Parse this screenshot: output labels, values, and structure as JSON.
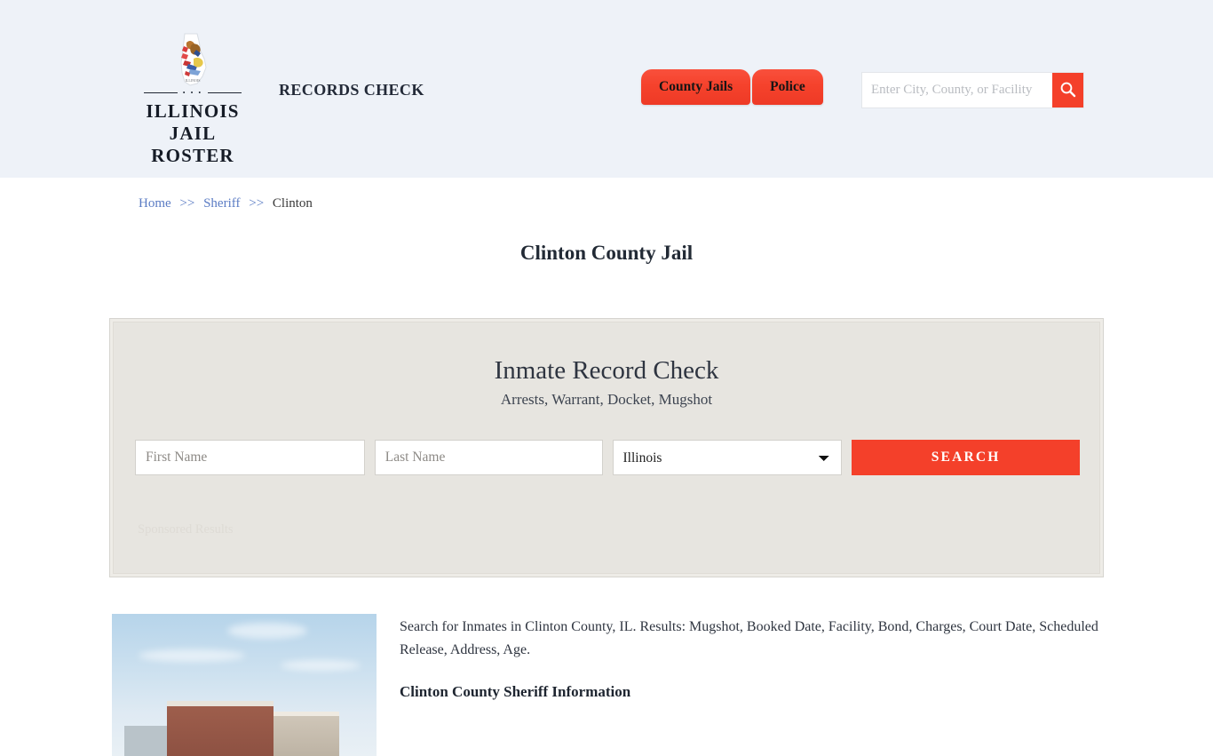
{
  "header": {
    "logo": {
      "mark_icon": "illinois-state-outline-flag-icon",
      "line1": "ILLINOIS",
      "line2": "JAIL ROSTER",
      "divider_dots": "• • •"
    },
    "tagline": "RECORDS CHECK",
    "nav": [
      {
        "label": "County Jails",
        "name": "county-jails"
      },
      {
        "label": "Police",
        "name": "police"
      }
    ],
    "search": {
      "placeholder": "Enter City, County, or Facility",
      "value": "",
      "button_icon": "search-icon"
    },
    "background": "#eef2f8",
    "accent": "#f4402a"
  },
  "breadcrumb": {
    "items": [
      {
        "label": "Home",
        "link": true
      },
      {
        "label": "Sheriff",
        "link": true
      },
      {
        "label": "Clinton",
        "link": false
      }
    ],
    "separator": ">>"
  },
  "page_title": "Clinton County Jail",
  "record_check": {
    "heading": "Inmate Record Check",
    "subheading": "Arrests, Warrant, Docket, Mugshot",
    "first_name_placeholder": "First Name",
    "first_name_value": "",
    "last_name_placeholder": "Last Name",
    "last_name_value": "",
    "state_selected": "Illinois",
    "state_options": [
      "Illinois"
    ],
    "search_button": "SEARCH",
    "sponsored_label": "Sponsored Results"
  },
  "content": {
    "image_alt": "clinton-county-jail-building-photo",
    "paragraph": "Search for Inmates in Clinton County, IL. Results: Mugshot, Booked Date, Facility, Bond, Charges, Court Date, Scheduled Release, Address, Age.",
    "subheading": "Clinton County Sheriff Information"
  }
}
